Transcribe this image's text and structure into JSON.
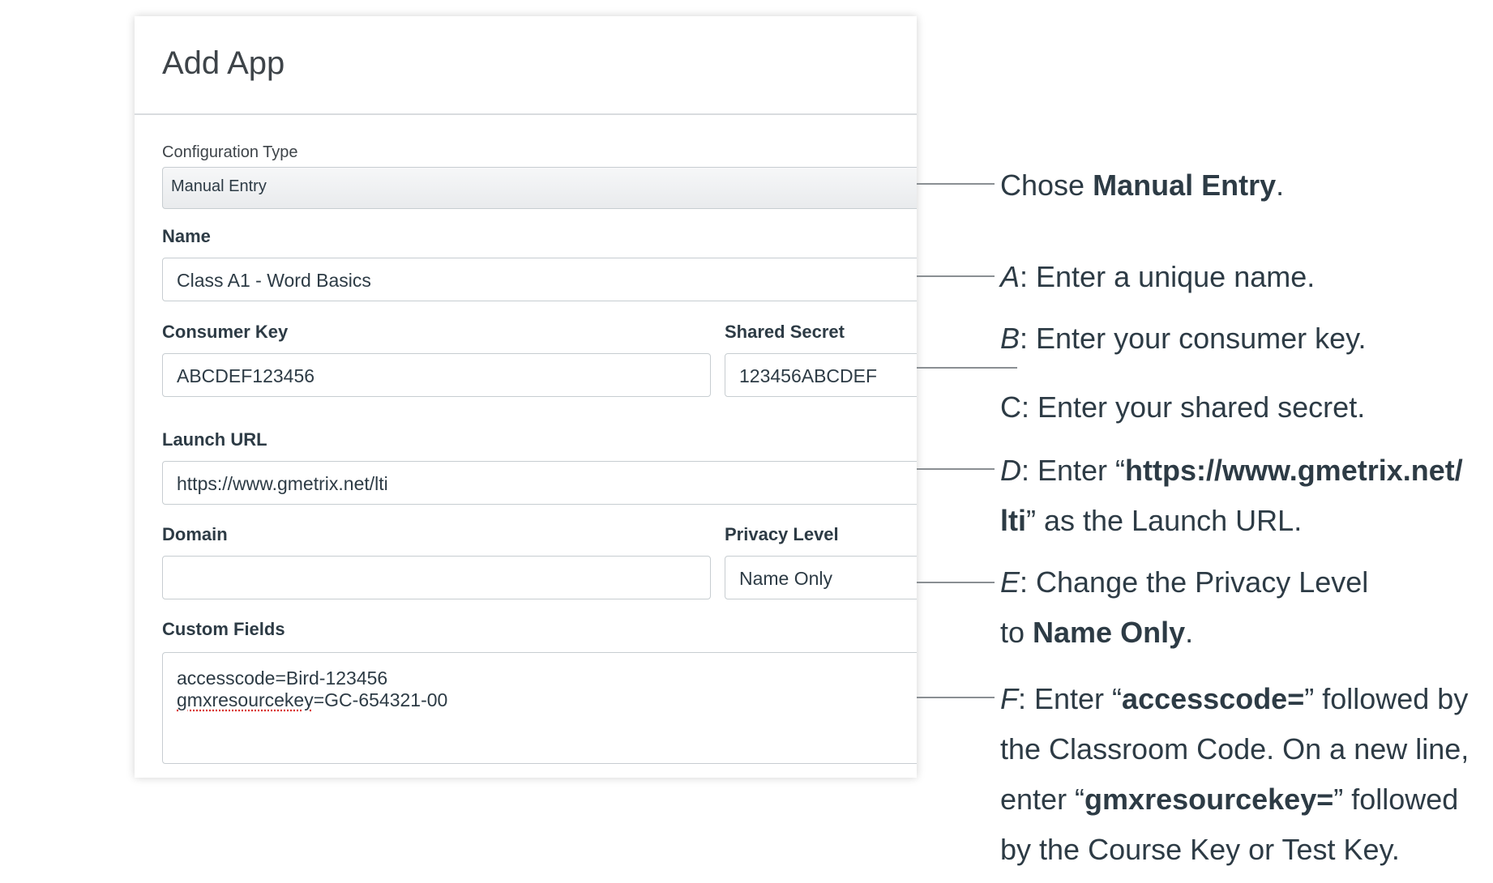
{
  "dialog": {
    "title": "Add App",
    "config_type": {
      "label": "Configuration Type",
      "value": "Manual Entry"
    },
    "name": {
      "label": "Name",
      "value": "Class A1 - Word Basics"
    },
    "consumer_key": {
      "label": "Consumer Key",
      "value": "ABCDEF123456"
    },
    "shared_secret": {
      "label": "Shared Secret",
      "value": "123456ABCDEF"
    },
    "launch_url": {
      "label": "Launch URL",
      "value": "https://www.gmetrix.net/lti"
    },
    "domain": {
      "label": "Domain",
      "value": ""
    },
    "privacy_level": {
      "label": "Privacy Level",
      "value": "Name Only"
    },
    "custom_fields": {
      "label": "Custom Fields",
      "line1": "accesscode=Bird-123456",
      "line2_misspelled": "gmxresourcekey",
      "line2_rest": "=GC-654321-00"
    }
  },
  "annotations": {
    "config": {
      "pre": "Chose ",
      "bold": "Manual Entry",
      "post": "."
    },
    "a": {
      "letter": "A",
      "text": ": Enter a unique name."
    },
    "b": {
      "letter": "B",
      "text": ": Enter your consumer key."
    },
    "c": {
      "text": "C: Enter your shared secret."
    },
    "d": {
      "letter": "D",
      "pre": ": Enter “",
      "bold1": "https://www.gmetrix.net/",
      "bold2": "lti",
      "post": "” as the Launch URL."
    },
    "e": {
      "letter": "E",
      "line1": ": Change the Privacy Level",
      "pre2": "to ",
      "bold": "Name Only",
      "post": "."
    },
    "f": {
      "letter": "F",
      "pre1": ": Enter “",
      "bold1": "accesscode=",
      "post1": "” followed by",
      "line2": "the Classroom Code. On a new line,",
      "pre3": "enter “",
      "bold3": "gmxresourcekey=",
      "post3": "” followed",
      "line4": "by the Course Key or Test Key."
    }
  }
}
